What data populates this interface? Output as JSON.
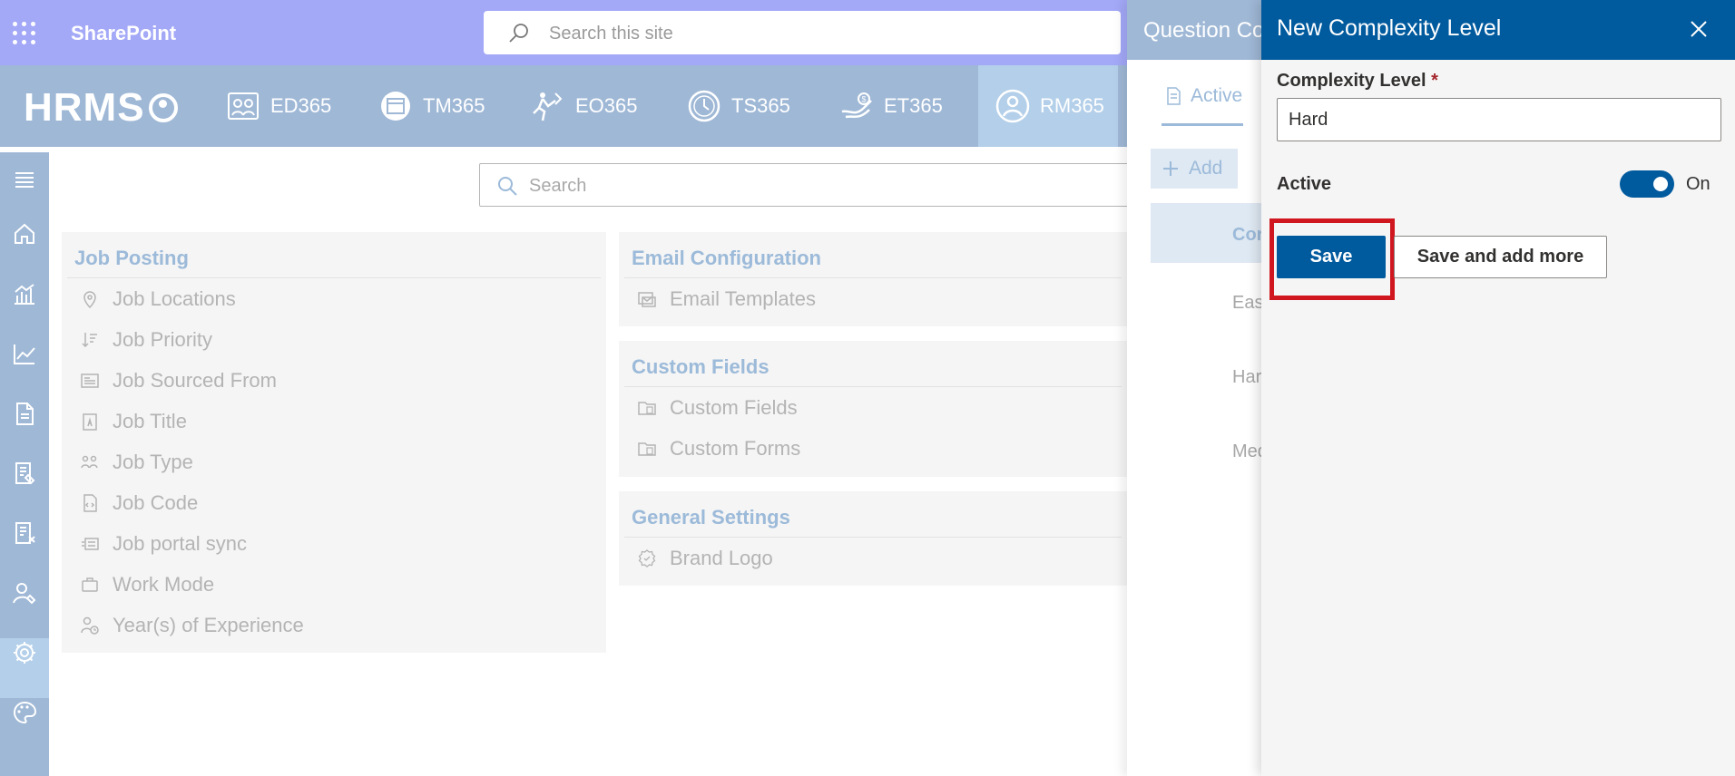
{
  "suite": {
    "brand": "SharePoint",
    "search_placeholder": "Search this site"
  },
  "appbar": {
    "logo": "HRMS",
    "modules": [
      {
        "label": "ED365",
        "icon": "employee-directory-icon"
      },
      {
        "label": "TM365",
        "icon": "time-management-icon"
      },
      {
        "label": "EO365",
        "icon": "onboarding-icon"
      },
      {
        "label": "TS365",
        "icon": "timesheet-icon"
      },
      {
        "label": "ET365",
        "icon": "expense-tracker-icon"
      },
      {
        "label": "RM365",
        "icon": "recruitment-icon",
        "active": true
      }
    ]
  },
  "rail": {
    "items": [
      "menu-icon",
      "home-icon",
      "analytics-icon",
      "line-chart-icon",
      "document-icon",
      "form-icon",
      "document-cancel-icon",
      "user-settings-icon",
      "settings-icon",
      "palette-icon"
    ],
    "selected": "settings-icon"
  },
  "main": {
    "search_placeholder": "Search",
    "job_posting": {
      "title": "Job Posting",
      "items": [
        "Job Locations",
        "Job Priority",
        "Job Sourced From",
        "Job Title",
        "Job Type",
        "Job Code",
        "Job portal sync",
        "Work Mode",
        "Year(s) of Experience"
      ]
    },
    "email_configuration": {
      "title": "Email Configuration",
      "items": [
        "Email Templates"
      ]
    },
    "custom_fields": {
      "title": "Custom Fields",
      "items": [
        "Custom Fields",
        "Custom Forms"
      ]
    },
    "general_settings": {
      "title": "General Settings",
      "items": [
        "Brand Logo"
      ]
    }
  },
  "question_panel": {
    "title": "Question Co",
    "tab": "Active",
    "add_label": "Add",
    "column_header": "Cor",
    "rows": [
      "Easy",
      "Hard",
      "Med"
    ]
  },
  "form": {
    "title": "New Complexity Level",
    "complexity_label": "Complexity Level",
    "required_mark": "*",
    "complexity_value": "Hard",
    "active_label": "Active",
    "toggle_state": "On",
    "save_label": "Save",
    "save_more_label": "Save and add more"
  },
  "colors": {
    "accent": "#005a9e",
    "highlight": "#d0161f",
    "suite": "#a3a8f7"
  }
}
